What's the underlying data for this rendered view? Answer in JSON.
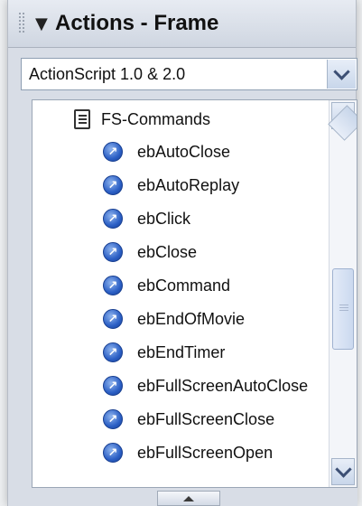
{
  "panel": {
    "title": "Actions - Frame"
  },
  "script_version": {
    "selected": "ActionScript 1.0 & 2.0"
  },
  "tree": {
    "folder": {
      "label": "FS-Commands",
      "icon": "book-icon"
    },
    "items": [
      {
        "label": "ebAutoClose",
        "icon": "action-arrow-icon"
      },
      {
        "label": "ebAutoReplay",
        "icon": "action-arrow-icon"
      },
      {
        "label": "ebClick",
        "icon": "action-arrow-icon"
      },
      {
        "label": "ebClose",
        "icon": "action-arrow-icon"
      },
      {
        "label": "ebCommand",
        "icon": "action-arrow-icon"
      },
      {
        "label": "ebEndOfMovie",
        "icon": "action-arrow-icon"
      },
      {
        "label": "ebEndTimer",
        "icon": "action-arrow-icon"
      },
      {
        "label": "ebFullScreenAutoClose",
        "icon": "action-arrow-icon"
      },
      {
        "label": "ebFullScreenClose",
        "icon": "action-arrow-icon"
      },
      {
        "label": "ebFullScreenOpen",
        "icon": "action-arrow-icon"
      }
    ]
  },
  "colors": {
    "item_icon": "#2b5fc5",
    "panel_bg": "#d8dde6"
  }
}
